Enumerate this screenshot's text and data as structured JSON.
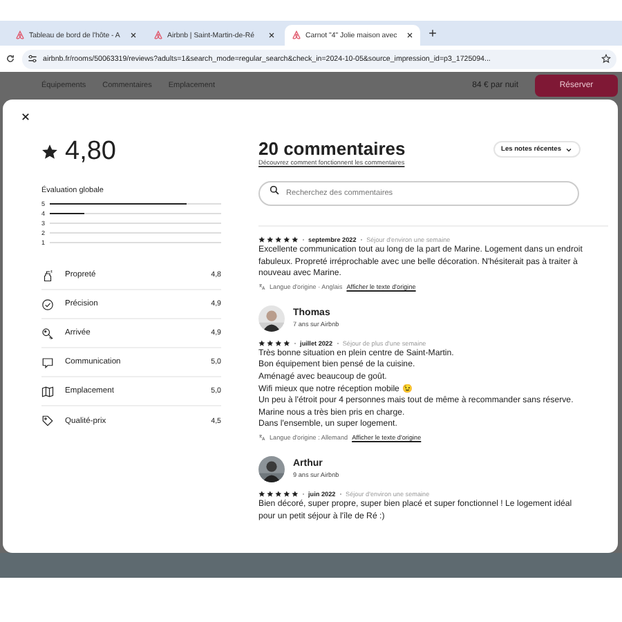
{
  "browser": {
    "tabs": [
      {
        "title": "Tableau de bord de l'hôte - A",
        "selected": false
      },
      {
        "title": "Airbnb | Saint-Martin-de-Ré",
        "selected": false
      },
      {
        "title": "Carnot \"4\" Jolie maison avec",
        "selected": true
      }
    ],
    "url": "airbnb.fr/rooms/50063319/reviews?adults=1&search_mode=regular_search&check_in=2024-10-05&source_impression_id=p3_1725094..."
  },
  "page": {
    "nav": [
      "Équipements",
      "Commentaires",
      "Emplacement"
    ],
    "price": "84 € par nuit",
    "reserve_button": "Réserver"
  },
  "modal": {
    "rating": "4,80",
    "overall_label": "Évaluation globale",
    "distribution": [
      {
        "label": "5",
        "level": 0.8
      },
      {
        "label": "4",
        "level": 0.2
      },
      {
        "label": "3"
      },
      {
        "label": "2"
      },
      {
        "label": "1"
      }
    ],
    "categories": [
      {
        "name": "Propreté",
        "score": "4,8"
      },
      {
        "name": "Précision",
        "score": "4,9"
      },
      {
        "name": "Arrivée",
        "score": "4,9"
      },
      {
        "name": "Communication",
        "score": "5,0"
      },
      {
        "name": "Emplacement",
        "score": "5,0"
      },
      {
        "name": "Qualité-prix",
        "score": "4,5"
      }
    ],
    "title": "20 commentaires",
    "help_link": "Découvrez comment fonctionnent les commentaires",
    "sort": "Les notes récentes",
    "search": {
      "placeholder": "Recherchez des commentaires"
    },
    "reviews": [
      {
        "stars": 5,
        "date": "septembre 2022",
        "stay": "Séjour d'environ une semaine",
        "lines": [
          {
            "text": "Excellente communication tout au long de la part de Marine. Logement dans un endroit fabuleux. Propreté irréprochable avec une belle décoration. N'hésiterait pas à traiter à nouveau avec Marine."
          }
        ],
        "language": "Langue d'origine · Anglais",
        "original_link": "Afficher le texte d'origine"
      },
      {
        "author": "Thomas",
        "member": "7 ans sur Airbnb",
        "stars": 4,
        "date": "juillet 2022",
        "stay": "Séjour de plus d'une semaine",
        "lines": [
          {
            "text": "Très bonne situation en plein centre de Saint-Martin."
          },
          {
            "text": "Bon équipement bien pensé de la cuisine."
          },
          {
            "text": "Aménagé avec beaucoup de goût."
          },
          {
            "text": "Wifi mieux que notre réception mobile",
            "emoji": "😉"
          },
          {
            "text": "Un peu à l'étroit pour 4 personnes mais tout de même à recommander sans réserve."
          },
          {
            "text": "Marine nous a très bien pris en charge."
          },
          {
            "text": "Dans l'ensemble, un super logement."
          }
        ],
        "language": "Langue d'origine : Allemand",
        "original_link": "Afficher le texte d'origine"
      },
      {
        "author": "Arthur",
        "member": "9 ans sur Airbnb",
        "stars": 5,
        "date": "juin 2022",
        "stay": "Séjour d'environ une semaine",
        "lines": [
          {
            "text": "Bien décoré, super propre, super bien placé et super fonctionnel ! Le logement idéal pour un petit séjour à l'île de Ré :)"
          }
        ]
      }
    ]
  }
}
